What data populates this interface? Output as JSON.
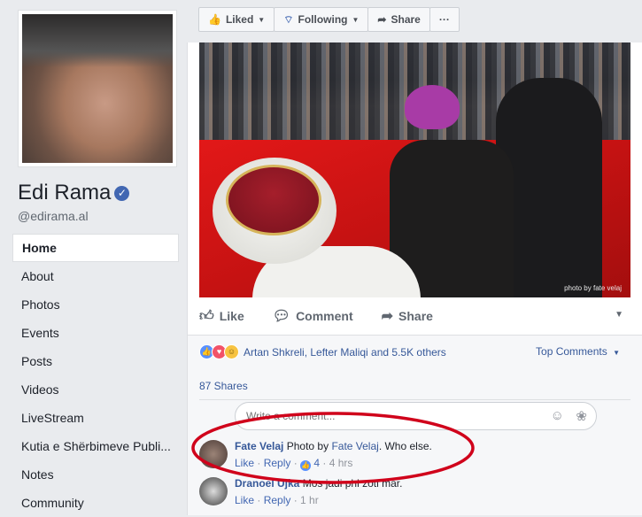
{
  "page": {
    "name": "Edi Rama",
    "handle": "@edirama.al"
  },
  "nav": {
    "items": [
      {
        "label": "Home",
        "active": true
      },
      {
        "label": "About"
      },
      {
        "label": "Photos"
      },
      {
        "label": "Events"
      },
      {
        "label": "Posts"
      },
      {
        "label": "Videos"
      },
      {
        "label": "LiveStream"
      },
      {
        "label": "Kutia e Shërbimeve Publi..."
      },
      {
        "label": "Notes"
      },
      {
        "label": "Community"
      }
    ]
  },
  "action_bar": {
    "liked": "Liked",
    "following": "Following",
    "share": "Share",
    "more": "···"
  },
  "post": {
    "photo_credit": "photo by fate velaj",
    "actions": {
      "like": "Like",
      "comment": "Comment",
      "share": "Share"
    },
    "reactions_text": "Artan Shkreli, Lefter Maliqi and 5.5K others",
    "top_comments": "Top Comments",
    "shares": "87 Shares",
    "composer_placeholder": "Write a comment...",
    "comments": [
      {
        "author": "Fate Velaj",
        "text_prefix": "Photo by",
        "text_link": "Fate Velaj",
        "text_suffix": ". Who else.",
        "like": "Like",
        "reply": "Reply",
        "like_count": "4",
        "time": "4 hrs"
      },
      {
        "author": "Dranoel Ujka",
        "text": "Mos jadi phi zoti mar.",
        "like": "Like",
        "reply": "Reply",
        "time": "1 hr"
      }
    ]
  },
  "colors": {
    "fb_blue": "#4267b2",
    "link": "#365899",
    "annotation_red": "#d0021b"
  }
}
